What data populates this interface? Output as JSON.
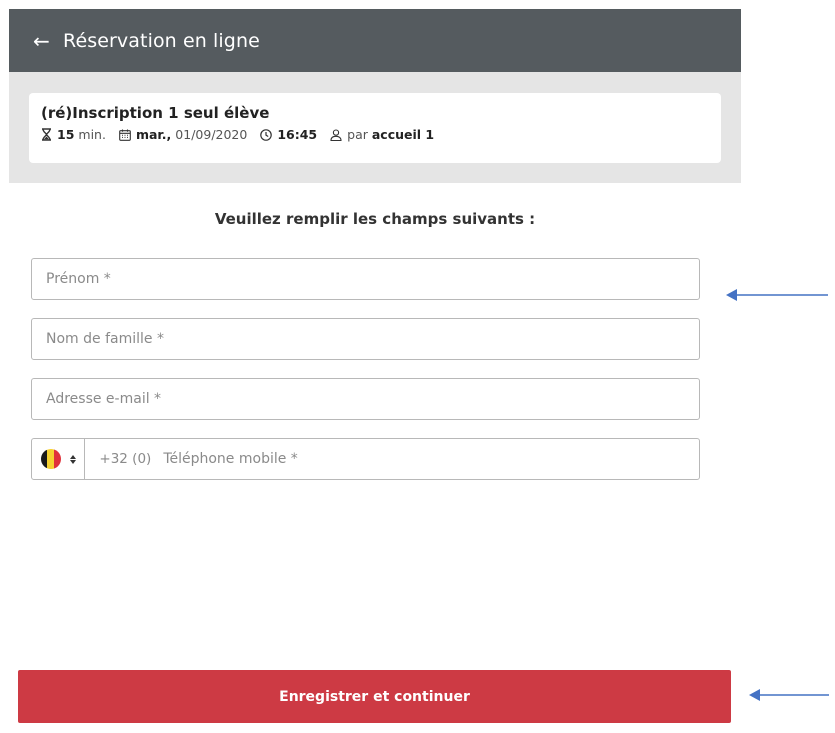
{
  "header": {
    "back_icon": "arrow-left-icon",
    "title": "Réservation en ligne"
  },
  "appointment": {
    "title": "(ré)Inscription 1 seul élève",
    "duration_value": "15",
    "duration_unit": "min.",
    "date_day": "mar.,",
    "date_value": "01/09/2020",
    "time": "16:45",
    "by_prefix": "par",
    "by_name": "accueil 1"
  },
  "instructions": "Veuillez remplir les champs suivants :",
  "form": {
    "first_name": {
      "value": "",
      "placeholder": "Prénom *"
    },
    "last_name": {
      "value": "",
      "placeholder": "Nom de famille *"
    },
    "email": {
      "value": "",
      "placeholder": "Adresse e-mail *"
    },
    "phone": {
      "country": "Belgium",
      "flag_icon": "belgium-flag-icon",
      "dial_code": "+32 (0)",
      "value": "",
      "placeholder": "Téléphone mobile *"
    }
  },
  "submit_label": "Enregistrer et continuer",
  "colors": {
    "header_bg": "#555b5f",
    "summary_bg": "#e5e5e5",
    "accent": "#cd3a44",
    "annotation_arrow": "#4472c4"
  }
}
